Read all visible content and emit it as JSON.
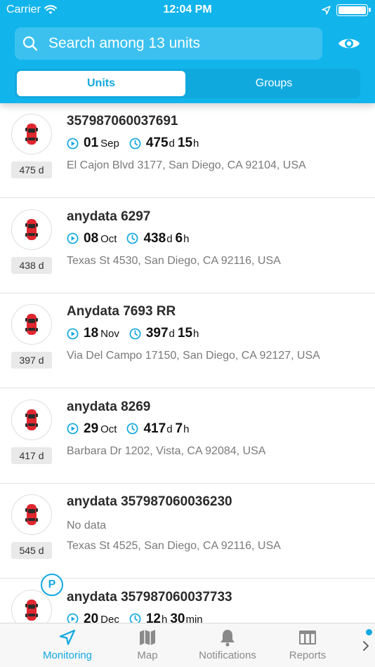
{
  "status": {
    "carrier": "Carrier",
    "time": "12:04 PM"
  },
  "search": {
    "placeholder": "Search among 13 units"
  },
  "segments": {
    "active": "Units",
    "inactive": "Groups"
  },
  "units": [
    {
      "name": "357987060037691",
      "day": "01",
      "month": "Sep",
      "dur_a": "475",
      "unit_a": "d",
      "dur_b": "15",
      "unit_b": "h",
      "address": "El Cajon Blvd 3177, San Diego, CA 92104, USA",
      "badge": "475 d"
    },
    {
      "name": "anydata 6297",
      "day": "08",
      "month": "Oct",
      "dur_a": "438",
      "unit_a": "d",
      "dur_b": "6",
      "unit_b": "h",
      "address": "Texas St 4530, San Diego, CA 92116, USA",
      "badge": "438 d"
    },
    {
      "name": "Anydata 7693 RR",
      "day": "18",
      "month": "Nov",
      "dur_a": "397",
      "unit_a": "d",
      "dur_b": "15",
      "unit_b": "h",
      "address": "Via Del Campo 17150, San Diego, CA 92127, USA",
      "badge": "397 d"
    },
    {
      "name": "anydata 8269",
      "day": "29",
      "month": "Oct",
      "dur_a": "417",
      "unit_a": "d",
      "dur_b": "7",
      "unit_b": "h",
      "address": "Barbara Dr 1202, Vista, CA 92084, USA",
      "badge": "417 d"
    },
    {
      "name": "anydata 357987060036230",
      "nodata": "No data",
      "address": "Texas St 4525, San Diego, CA 92116, USA",
      "badge": "545 d"
    },
    {
      "name": "anydata 357987060037733",
      "day": "20",
      "month": "Dec",
      "dur_a": "12",
      "unit_a": "h",
      "dur_b": "30",
      "unit_b": "min",
      "p_badge": "P"
    }
  ],
  "tabs": [
    {
      "label": "Monitoring",
      "icon": "navigation-arrow-icon",
      "active": true
    },
    {
      "label": "Map",
      "icon": "map-icon"
    },
    {
      "label": "Notifications",
      "icon": "bell-icon"
    },
    {
      "label": "Reports",
      "icon": "reports-icon"
    }
  ],
  "colors": {
    "accent": "#12b4ec",
    "active_text": "#12a8e0",
    "car": "#e0262f"
  }
}
